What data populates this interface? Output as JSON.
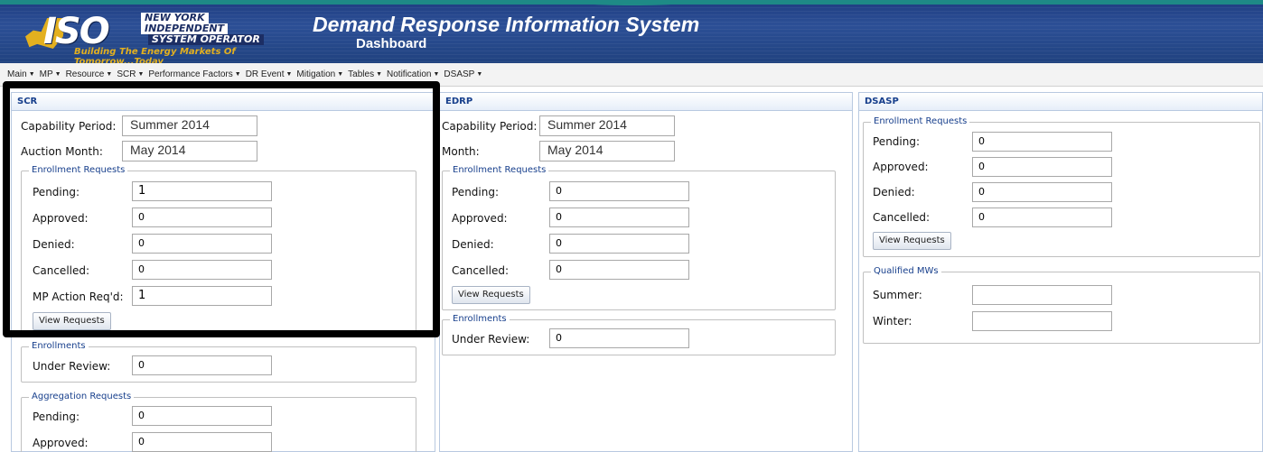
{
  "header": {
    "logo_text": "ISO",
    "logo_line1": "NEW YORK",
    "logo_line2": "INDEPENDENT",
    "logo_line3": "SYSTEM OPERATOR",
    "tagline": "Building The Energy Markets Of Tomorrow...Today",
    "app_title": "Demand Response Information System",
    "page_subtitle": "Dashboard"
  },
  "menu": {
    "items": [
      {
        "label": "Main"
      },
      {
        "label": "MP"
      },
      {
        "label": "Resource"
      },
      {
        "label": "SCR"
      },
      {
        "label": "Performance Factors"
      },
      {
        "label": "DR Event"
      },
      {
        "label": "Mitigation"
      },
      {
        "label": "Tables"
      },
      {
        "label": "Notification"
      },
      {
        "label": "DSASP"
      }
    ],
    "caret_icon": "caret-down-icon"
  },
  "scr": {
    "title": "SCR",
    "capability_period_label": "Capability Period:",
    "capability_period_value": "Summer 2014",
    "auction_month_label": "Auction Month:",
    "auction_month_value": "May 2014",
    "enrollment_requests": {
      "legend": "Enrollment Requests",
      "pending_label": "Pending:",
      "pending_value": "1",
      "approved_label": "Approved:",
      "approved_value": "0",
      "denied_label": "Denied:",
      "denied_value": "0",
      "cancelled_label": "Cancelled:",
      "cancelled_value": "0",
      "mp_action_label": "MP Action Req'd:",
      "mp_action_value": "1",
      "view_button": "View Requests"
    },
    "enrollments": {
      "legend": "Enrollments",
      "under_review_label": "Under Review:",
      "under_review_value": "0"
    },
    "aggregation_requests": {
      "legend": "Aggregation Requests",
      "pending_label": "Pending:",
      "pending_value": "0",
      "approved_label": "Approved:",
      "approved_value": "0"
    }
  },
  "edrp": {
    "title": "EDRP",
    "capability_period_label": "Capability Period:",
    "capability_period_value": "Summer 2014",
    "month_label": "Month:",
    "month_value": "May 2014",
    "enrollment_requests": {
      "legend": "Enrollment Requests",
      "pending_label": "Pending:",
      "pending_value": "0",
      "approved_label": "Approved:",
      "approved_value": "0",
      "denied_label": "Denied:",
      "denied_value": "0",
      "cancelled_label": "Cancelled:",
      "cancelled_value": "0",
      "view_button": "View Requests"
    },
    "enrollments": {
      "legend": "Enrollments",
      "under_review_label": "Under Review:",
      "under_review_value": "0"
    }
  },
  "dsasp": {
    "title": "DSASP",
    "enrollment_requests": {
      "legend": "Enrollment Requests",
      "pending_label": "Pending:",
      "pending_value": "0",
      "approved_label": "Approved:",
      "approved_value": "0",
      "denied_label": "Denied:",
      "denied_value": "0",
      "cancelled_label": "Cancelled:",
      "cancelled_value": "0",
      "view_button": "View Requests"
    },
    "qualified_mws": {
      "legend": "Qualified MWs",
      "summer_label": "Summer:",
      "summer_value": "",
      "winter_label": "Winter:",
      "winter_value": ""
    }
  },
  "colors": {
    "header_bg": "#1e3d80",
    "accent_gold": "#e3b01f",
    "panel_title": "#173f8c",
    "teal": "#1e8a86"
  }
}
